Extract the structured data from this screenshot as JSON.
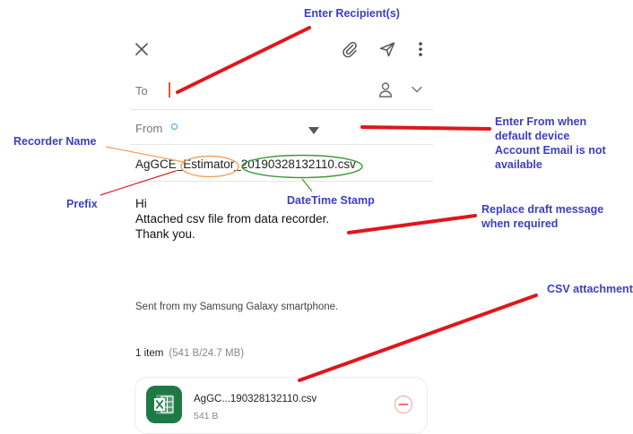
{
  "compose": {
    "to_label": "To",
    "from_label": "From",
    "subject": "AgGCE_Estimator_20190328132110.csv",
    "body_lines": [
      "Hi",
      "Attached csv file from data recorder.",
      "Thank you."
    ],
    "signature": "Sent from my Samsung Galaxy smartphone.",
    "items_count": "1 item",
    "items_size": "(541 B/24.7 MB)",
    "attachment": {
      "name": "AgGC...190328132110.csv",
      "size": "541 B",
      "icon": "excel-file-icon"
    }
  },
  "toolbar": {
    "icons": [
      "close-icon",
      "paperclip-icon",
      "send-icon",
      "more-vertical-icon"
    ]
  },
  "annotations": {
    "recipients": "Enter Recipient(s)",
    "from_lines": [
      "Enter From when",
      "default device",
      "Account Email is not",
      "available"
    ],
    "recorder_name": "Recorder Name",
    "prefix": "Prefix",
    "datetime": "DateTime Stamp",
    "draft_lines": [
      "Replace draft message",
      "when required"
    ],
    "csv": "CSV attachment"
  },
  "colors": {
    "annotation_text": "#3b3fc4",
    "annotation_line": "#e0161b",
    "orange_ellipse": "#f0a060",
    "green_ellipse": "#3a9a3a",
    "excel_green": "#1d7a45",
    "caret": "#e05a2b"
  }
}
